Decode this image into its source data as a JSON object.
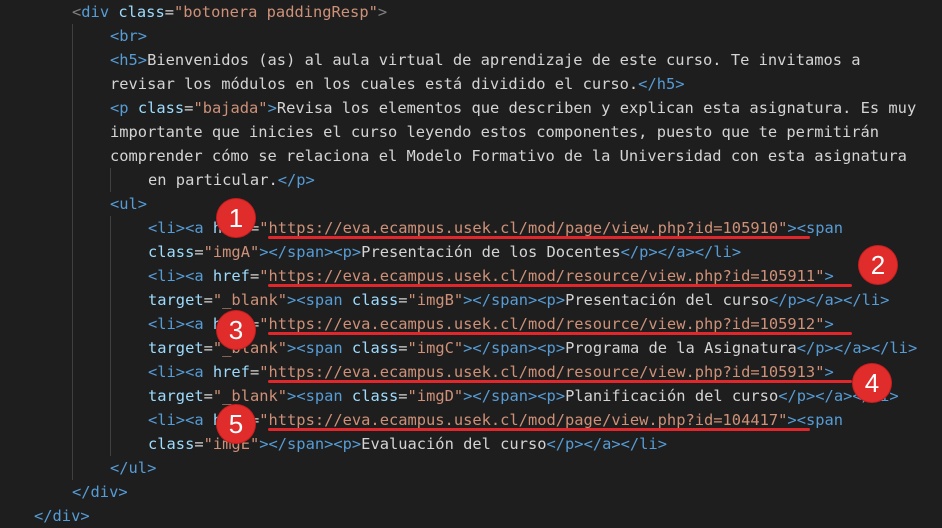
{
  "code": {
    "l01": {
      "open": "<",
      "tag": "div",
      "sp": " ",
      "attr": "class",
      "eq": "=",
      "val": "\"botonera paddingResp\"",
      "close": ">"
    },
    "l02": {
      "tag": "<br>"
    },
    "l03": {
      "h5open": "<h5>",
      "text": "Bienvenidos (as) al aula virtual de aprendizaje de este curso. Te invitamos a"
    },
    "l04": {
      "text": "revisar los módulos en los cuales está dividido el curso.",
      "h5close": "</h5>"
    },
    "l05": {
      "open": "<p ",
      "attr": "class",
      "eq": "=",
      "val": "\"bajada\"",
      "gt": ">",
      "text": "Revisa los elementos que describen y explican esta asignatura. Es muy"
    },
    "l06": {
      "text": "importante que inicies el curso leyendo estos componentes, puesto que te permitirán"
    },
    "l07": {
      "text": "comprender cómo se relaciona el Modelo Formativo de la Universidad con esta asignatura"
    },
    "l08": {
      "text": "en particular.",
      "pclose": "</p>"
    },
    "l09": {
      "tag": "<ul>"
    },
    "l10": {
      "li": "<li><a ",
      "attr": "href",
      "eq": "=",
      "val": "\"https://eva.ecampus.usek.cl/mod/page/view.php?id=105910\"",
      "gt": ">",
      "span": "<span"
    },
    "l11": {
      "attr": "class",
      "eq": "=",
      "val": "\"imgA\"",
      "mid": "></span><p>",
      "text": "Presentación de los Docentes",
      "end": "</p></a></li>"
    },
    "l12": {
      "li": "<li><a ",
      "attr": "href",
      "eq": "=",
      "val": "\"https://eva.ecampus.usek.cl/mod/resource/view.php?id=105911\"",
      "gt": ">"
    },
    "l13": {
      "attr": "target",
      "eq": "=",
      "val": "\"_blank\"",
      "gt": ">",
      "span": "<span ",
      "attr2": "class",
      "eq2": "=",
      "val2": "\"imgB\"",
      "mid": "></span><p>",
      "text": "Presentación del curso",
      "end": "</p></a></li>"
    },
    "l14": {
      "li": "<li><a ",
      "attr": "href",
      "eq": "=",
      "val": "\"https://eva.ecampus.usek.cl/mod/resource/view.php?id=105912\"",
      "gt": ">"
    },
    "l15": {
      "attr": "target",
      "eq": "=",
      "val": "\"_blank\"",
      "gt": ">",
      "span": "<span ",
      "attr2": "class",
      "eq2": "=",
      "val2": "\"imgC\"",
      "mid": "></span><p>",
      "text": "Programa de la Asignatura",
      "end": "</p></a></li>"
    },
    "l16": {
      "li": "<li><a ",
      "attr": "href",
      "eq": "=",
      "val": "\"https://eva.ecampus.usek.cl/mod/resource/view.php?id=105913\"",
      "gt": ">"
    },
    "l17": {
      "attr": "target",
      "eq": "=",
      "val": "\"_blank\"",
      "gt": ">",
      "span": "<span ",
      "attr2": "class",
      "eq2": "=",
      "val2": "\"imgD\"",
      "mid": "></span><p>",
      "text": "Planificación del curso",
      "end": "</p></a></li>"
    },
    "l18": {
      "li": "<li><a ",
      "attr": "href",
      "eq": "=",
      "val": "\"https://eva.ecampus.usek.cl/mod/page/view.php?id=104417\"",
      "gt": ">",
      "span": "<span"
    },
    "l19": {
      "attr": "class",
      "eq": "=",
      "val": "\"imgE\"",
      "mid": "></span><p>",
      "text": "Evaluación del curso",
      "end": "</p></a></li>"
    },
    "l20": {
      "tag": "</ul>"
    },
    "l21": {
      "tag": "</div>"
    },
    "l22": {
      "tag": "</div>"
    }
  },
  "annotations": {
    "badges": [
      "1",
      "2",
      "3",
      "4",
      "5"
    ],
    "color": "#e12c2c"
  }
}
